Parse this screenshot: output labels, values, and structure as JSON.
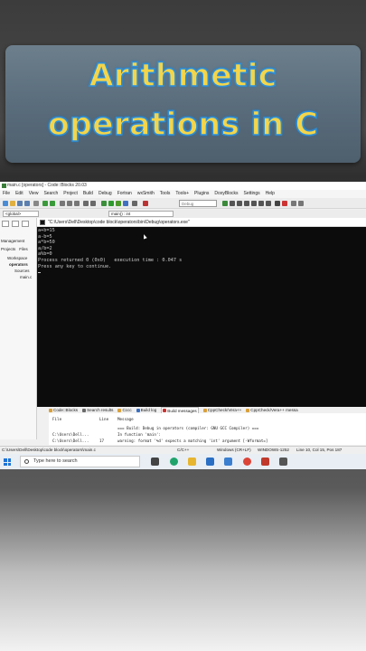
{
  "banner": {
    "line1": "Arithmetic",
    "line2": "operations in C"
  },
  "window": {
    "title": "main.c [operators] - Code::Blocks 20.03"
  },
  "menu": [
    "File",
    "Edit",
    "View",
    "Search",
    "Project",
    "Build",
    "Debug",
    "Fortran",
    "wxSmith",
    "Tools",
    "Tools+",
    "Plugins",
    "DoxyBlocks",
    "Settings",
    "Help"
  ],
  "toolbar": {
    "build_target": "Debug"
  },
  "scope": {
    "global": "<global>",
    "function": "main() : int"
  },
  "sidebar": {
    "title": "Management",
    "tabs": [
      "Projects",
      "Files"
    ],
    "tree": [
      "Workspace",
      "operators",
      "Sources",
      "main.c"
    ]
  },
  "console": {
    "title": "\"C:\\Users\\Dell\\Desktop\\code block\\operators\\bin\\Debug\\operators.exe\"",
    "lines": [
      "a+b=15",
      "a-b=5",
      "a*b=50",
      "a/b=2",
      "a%b=0",
      "Process returned 0 (0x0)   execution time : 0.047 s",
      "Press any key to continue."
    ]
  },
  "log_tabs": [
    "Code::Blocks",
    "Search results",
    "Cccc",
    "Build log",
    "Build messages",
    "CppCheck/Vera++",
    "CppCheck/Vera++ messa"
  ],
  "log_table": {
    "headers": [
      "File",
      "Line",
      "Message"
    ],
    "rows": [
      [
        "",
        "",
        "=== Build: Debug in operators (compiler: GNU GCC Compiler) ==="
      ],
      [
        "C:\\Users\\Dell...",
        "",
        "In function 'main':"
      ],
      [
        "C:\\Users\\Dell...",
        "17",
        "warning: format '%d' expects a matching 'int' argument [-Wformat=]"
      ]
    ]
  },
  "status": {
    "path": "C:\\Users\\Dell\\Desktop\\code block\\operators\\main.c",
    "language": "C/C++",
    "eol": "Windows (CR+LF)",
    "encoding": "WINDOWS-1252",
    "position": "Line 10, Col 15, Pos 187"
  },
  "taskbar": {
    "search_placeholder": "Type here to search"
  }
}
